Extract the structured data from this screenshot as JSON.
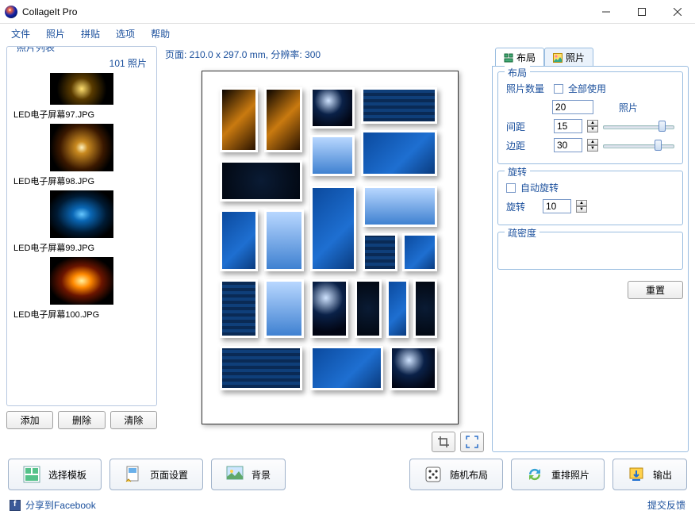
{
  "app": {
    "title": "CollageIt Pro"
  },
  "menu": {
    "file": "文件",
    "photo": "照片",
    "collage": "拼贴",
    "options": "选项",
    "help": "帮助"
  },
  "sidebar": {
    "legend": "照片列表",
    "count_label": "101 照片",
    "items": [
      {
        "caption": "LED电子屏幕97.JPG"
      },
      {
        "caption": "LED电子屏幕98.JPG"
      },
      {
        "caption": "LED电子屏幕99.JPG"
      },
      {
        "caption": "LED电子屏幕100.JPG"
      }
    ],
    "buttons": {
      "add": "添加",
      "delete": "删除",
      "clear": "清除"
    }
  },
  "center": {
    "page_info": "页面: 210.0 x 297.0 mm, 分辨率: 300"
  },
  "right": {
    "tabs": {
      "layout": "布局",
      "photo": "照片"
    },
    "layout": {
      "legend": "布局",
      "count_label": "照片数量",
      "use_all": "全部使用",
      "count_value": "20",
      "photo_label": "照片",
      "spacing_label": "间距",
      "spacing_value": "15",
      "margin_label": "边距",
      "margin_value": "30"
    },
    "rotation": {
      "legend": "旋转",
      "auto": "自动旋转",
      "label": "旋转",
      "value": "10"
    },
    "density": {
      "legend": "疏密度"
    },
    "reset": "重置"
  },
  "toolbar": {
    "template": "选择模板",
    "page": "页面设置",
    "background": "背景",
    "random": "随机布局",
    "rearrange": "重排照片",
    "export": "输出"
  },
  "footer": {
    "share": "分享到Facebook",
    "feedback": "提交反馈"
  }
}
